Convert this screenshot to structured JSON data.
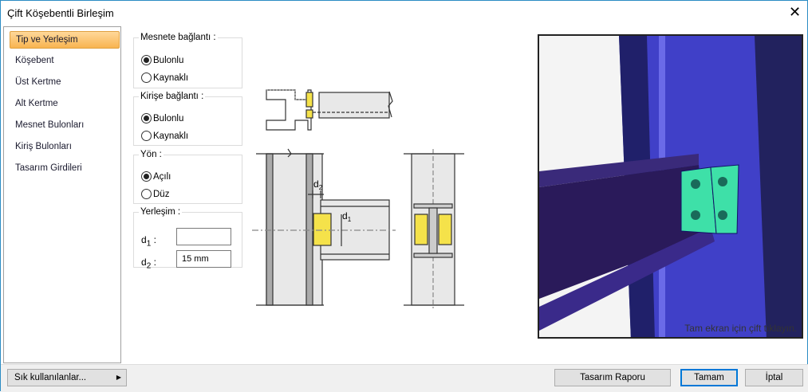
{
  "window": {
    "title": "Çift Köşebentli Birleşim",
    "close": "✕"
  },
  "sidebar": {
    "items": [
      {
        "label": "Tip ve Yerleşim",
        "active": true
      },
      {
        "label": "Köşebent"
      },
      {
        "label": "Üst Kertme"
      },
      {
        "label": "Alt Kertme"
      },
      {
        "label": "Mesnet Bulonları"
      },
      {
        "label": "Kiriş Bulonları"
      },
      {
        "label": "Tasarım Girdileri"
      }
    ]
  },
  "groups": {
    "mesnet": {
      "legend": "Mesnete bağlantı :",
      "options": [
        "Bulonlu",
        "Kaynaklı"
      ],
      "selected": 0
    },
    "kiris": {
      "legend": "Kirişe bağlantı :",
      "options": [
        "Bulonlu",
        "Kaynaklı"
      ],
      "selected": 0
    },
    "yon": {
      "legend": "Yön :",
      "options": [
        "Açılı",
        "Düz"
      ],
      "selected": 0
    },
    "yerlesim": {
      "legend": "Yerleşim :",
      "d1_label": "d",
      "d1_sub": "1",
      "d2_label": "d",
      "d2_sub": "2",
      "colon": ":",
      "d1_value": "",
      "d2_value": "15 mm"
    }
  },
  "drawing": {
    "d2": "d",
    "d2_sub": "2",
    "d1": "d",
    "d1_sub": "1"
  },
  "viewer": {
    "hint": "Tam ekran için çift tıklayın."
  },
  "footer": {
    "favorites": "Sık kullanılanlar...",
    "report": "Tasarım Raporu",
    "ok": "Tamam",
    "cancel": "İptal"
  },
  "colors": {
    "accent": "#f8b450",
    "plate": "#f5e24a",
    "steel": "#3e3ec8",
    "angle": "#3ee0a8"
  }
}
